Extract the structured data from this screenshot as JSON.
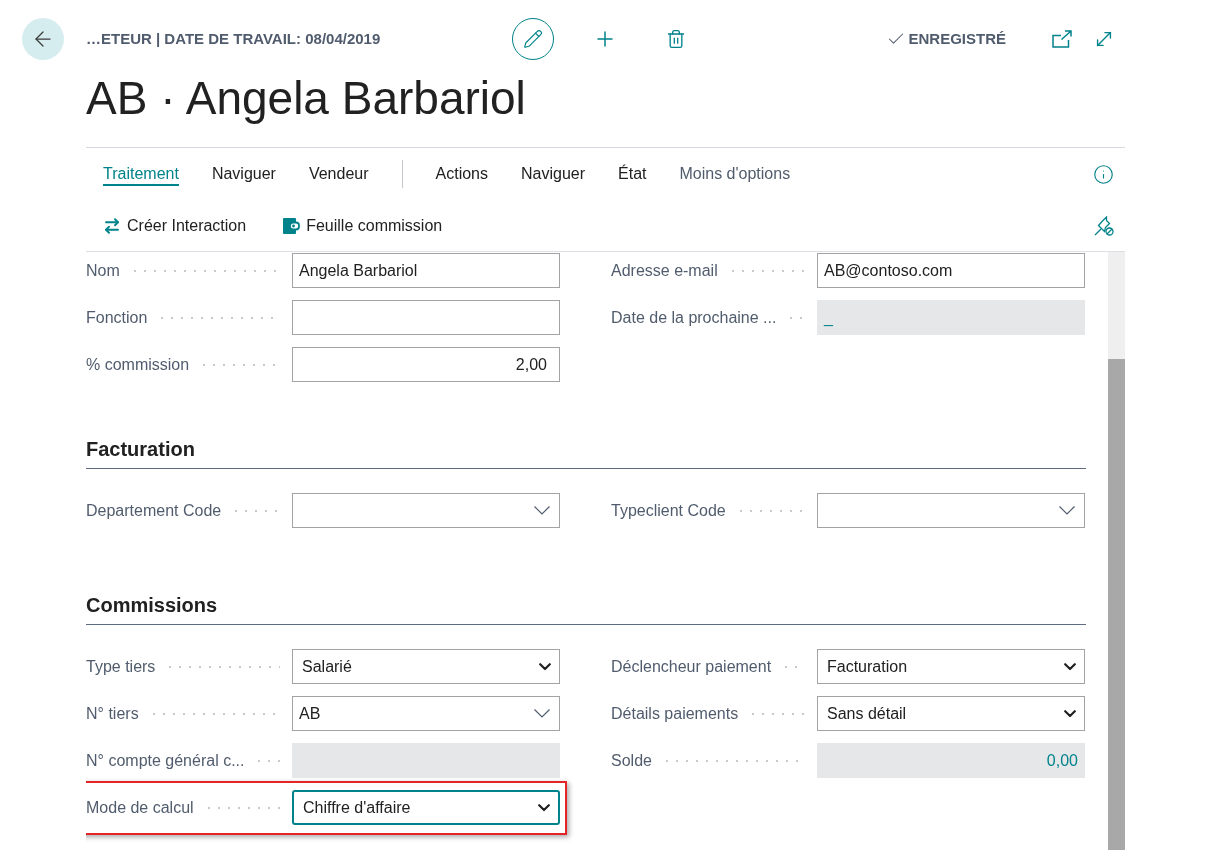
{
  "header": {
    "breadcrumb": "…ETEUR | DATE DE TRAVAIL: 08/04/2019",
    "save_status": "ENREGISTRÉ",
    "title": "AB · Angela Barbariol"
  },
  "promoted_tabs": [
    {
      "label": "Traitement",
      "selected": true
    },
    {
      "label": "Naviguer",
      "selected": false
    },
    {
      "label": "Vendeur",
      "selected": false
    }
  ],
  "menus": [
    "Actions",
    "Naviguer",
    "État"
  ],
  "options_toggle": "Moins d'options",
  "actions": [
    {
      "label": "Créer Interaction"
    },
    {
      "label": "Feuille commission"
    }
  ],
  "sections": [
    {
      "columns": [
        [
          {
            "label": "Nom",
            "kind": "text",
            "value": "Angela Barbariol",
            "focused": false,
            "highlighted": false
          },
          {
            "label": "Fonction",
            "kind": "text",
            "focused": false,
            "highlighted": false
          },
          {
            "label": "% commission",
            "kind": "number",
            "value": "2,00",
            "focused": false,
            "highlighted": false
          }
        ],
        [
          {
            "label": "Adresse e-mail",
            "kind": "text",
            "value": "AB@contoso.com",
            "focused": false,
            "highlighted": false
          },
          {
            "label": "Date de la prochaine ...",
            "kind": "readonly",
            "value": "_",
            "focused": false,
            "highlighted": false
          }
        ]
      ]
    },
    {
      "title": "Facturation",
      "columns": [
        [
          {
            "label": "Departement Code",
            "kind": "lookup",
            "focused": false,
            "highlighted": false
          }
        ],
        [
          {
            "label": "Typeclient Code",
            "kind": "lookup",
            "focused": false,
            "highlighted": false
          }
        ]
      ]
    },
    {
      "title": "Commissions",
      "columns": [
        [
          {
            "label": "Type tiers",
            "kind": "select",
            "value": "Salarié",
            "focused": false,
            "highlighted": false
          },
          {
            "label": "N° tiers",
            "kind": "lookup",
            "value": "AB",
            "focused": false,
            "highlighted": false
          },
          {
            "label": "N° compte général c...",
            "kind": "readonly",
            "focused": false,
            "highlighted": false
          },
          {
            "label": "Mode de calcul",
            "kind": "select",
            "value": "Chiffre d'affaire",
            "focused": true,
            "highlighted": true
          }
        ],
        [
          {
            "label": "Déclencheur paiement",
            "kind": "select",
            "value": "Facturation",
            "focused": false,
            "highlighted": false
          },
          {
            "label": "Détails paiements",
            "kind": "select",
            "value": "Sans détail",
            "focused": false,
            "highlighted": false
          },
          {
            "label": "Solde",
            "kind": "readonly_number",
            "value": "0,00",
            "focused": false,
            "highlighted": false
          }
        ]
      ]
    }
  ]
}
